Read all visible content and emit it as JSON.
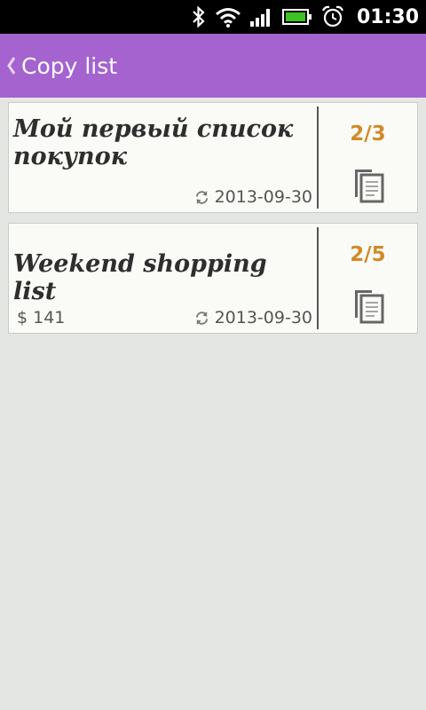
{
  "status_bar": {
    "time": "01:30",
    "icons": [
      "bluetooth-icon",
      "wifi-icon",
      "signal-icon",
      "battery-icon",
      "alarm-icon"
    ]
  },
  "action_bar": {
    "title": "Copy list",
    "color": "#a463cf"
  },
  "lists": [
    {
      "title": "Мой первый список покупок",
      "price": "",
      "date": "2013-09-30",
      "count": "2/3"
    },
    {
      "title": "Weekend shopping list",
      "price": "$ 141",
      "date": "2013-09-30",
      "count": "2/5"
    }
  ],
  "colors": {
    "count": "#d18a2a",
    "background": "#e4e6e3",
    "card": "#fafbf7"
  }
}
